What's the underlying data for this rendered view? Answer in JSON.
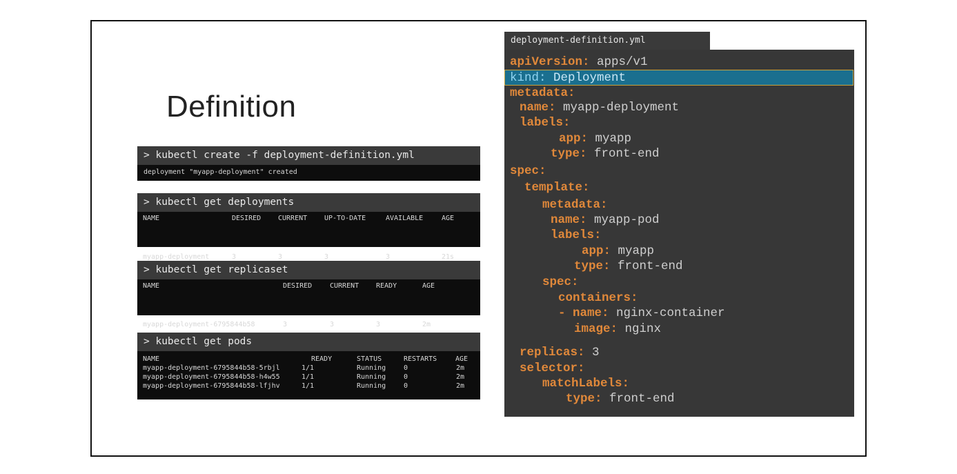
{
  "slide": {
    "title": "Definition"
  },
  "terminals": {
    "create": {
      "command": "> kubectl create -f deployment-definition.yml",
      "output": "deployment \"myapp-deployment\" created"
    },
    "deployments": {
      "command": "> kubectl get deployments",
      "headers": [
        "NAME",
        "DESIRED",
        "CURRENT",
        "UP-TO-DATE",
        "AVAILABLE",
        "AGE"
      ],
      "rows": [
        [
          "myapp-deployment",
          "3",
          "3",
          "3",
          "3",
          "21s"
        ]
      ]
    },
    "replicaset": {
      "command": "> kubectl get replicaset",
      "headers": [
        "NAME",
        "DESIRED",
        "CURRENT",
        "READY",
        "AGE"
      ],
      "rows": [
        [
          "myapp-deployment-6795844b58",
          "3",
          "3",
          "3",
          "2m"
        ]
      ]
    },
    "pods": {
      "command": "> kubectl get pods",
      "headers": [
        "NAME",
        "READY",
        "STATUS",
        "RESTARTS",
        "AGE"
      ],
      "rows": [
        [
          "myapp-deployment-6795844b58-5rbjl",
          "1/1",
          "Running",
          "0",
          "2m"
        ],
        [
          "myapp-deployment-6795844b58-h4w55",
          "1/1",
          "Running",
          "0",
          "2m"
        ],
        [
          "myapp-deployment-6795844b58-lfjhv",
          "1/1",
          "Running",
          "0",
          "2m"
        ]
      ]
    }
  },
  "yaml": {
    "filename": "deployment-definition.yml",
    "lines": [
      {
        "key": "apiVersion:",
        "value": " apps/v1"
      },
      {
        "key": "kind:",
        "value": " Deployment"
      },
      {
        "key": "metadata:",
        "value": ""
      },
      {
        "key": "name:",
        "value": " myapp-deployment"
      },
      {
        "key": "labels:",
        "value": ""
      },
      {
        "key": "app:",
        "value": " myapp"
      },
      {
        "key": "type:",
        "value": " front-end"
      },
      {
        "key": "spec:",
        "value": ""
      },
      {
        "key": "template:",
        "value": ""
      },
      {
        "key": "metadata:",
        "value": ""
      },
      {
        "key": "name:",
        "value": " myapp-pod"
      },
      {
        "key": "labels:",
        "value": ""
      },
      {
        "key": "app:",
        "value": " myapp"
      },
      {
        "key": "type:",
        "value": " front-end"
      },
      {
        "key": "spec:",
        "value": ""
      },
      {
        "key": "containers:",
        "value": ""
      },
      {
        "key": "- name:",
        "value": " nginx-container"
      },
      {
        "key": "image:",
        "value": " nginx"
      },
      {
        "key": "replicas:",
        "value": " 3"
      },
      {
        "key": "selector:",
        "value": ""
      },
      {
        "key": "matchLabels:",
        "value": ""
      },
      {
        "key": "type:",
        "value": " front-end"
      }
    ]
  },
  "colors": {
    "yaml_key": "#e0883a",
    "yaml_value": "#cfcfcf",
    "highlight": "#1a6f8f",
    "terminal_bg": "#0d0d0d",
    "terminal_cmd_bg": "#3a3a3a"
  }
}
